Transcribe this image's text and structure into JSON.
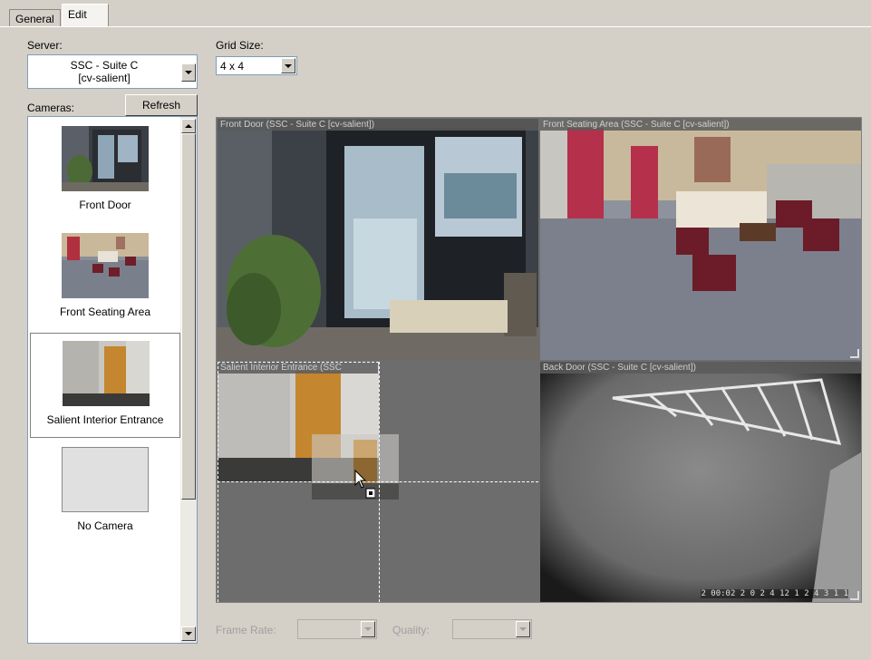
{
  "tabs": [
    {
      "label": "General",
      "active": false
    },
    {
      "label": "Edit",
      "active": true
    }
  ],
  "server": {
    "label": "Server:",
    "value_line1": "SSC - Suite C",
    "value_line2": "[cv-salient]"
  },
  "grid_size": {
    "label": "Grid Size:",
    "value": "4 x 4"
  },
  "cameras": {
    "label": "Cameras:",
    "refresh_label": "Refresh",
    "items": [
      {
        "name": "Front Door",
        "selected": false
      },
      {
        "name": "Front Seating Area",
        "selected": false
      },
      {
        "name": "Salient Interior Entrance",
        "selected": true
      },
      {
        "name": "No Camera",
        "selected": false
      }
    ]
  },
  "tiles": [
    {
      "title": "Front Door (SSC - Suite C [cv-salient])"
    },
    {
      "title": "Front Seating Area (SSC - Suite C [cv-salient])"
    },
    {
      "title": "Salient Interior Entrance (SSC"
    },
    {
      "title": "Back Door (SSC - Suite C [cv-salient])"
    }
  ],
  "back_door_overlay": "2 00:02 2 0 2 4 12 1 2 4 3 1  1",
  "frame_rate": {
    "label": "Frame Rate:",
    "value": ""
  },
  "quality": {
    "label": "Quality:",
    "value": ""
  },
  "colors": {
    "window_bg": "#d4d0c8",
    "grid_bg": "#6d6d6d",
    "tile_title_text": "#cfcfcf"
  },
  "icons": [
    "dropdown-arrow-icon",
    "scroll-up-icon",
    "scroll-down-icon",
    "move-cursor-icon",
    "resize-grip-icon"
  ]
}
